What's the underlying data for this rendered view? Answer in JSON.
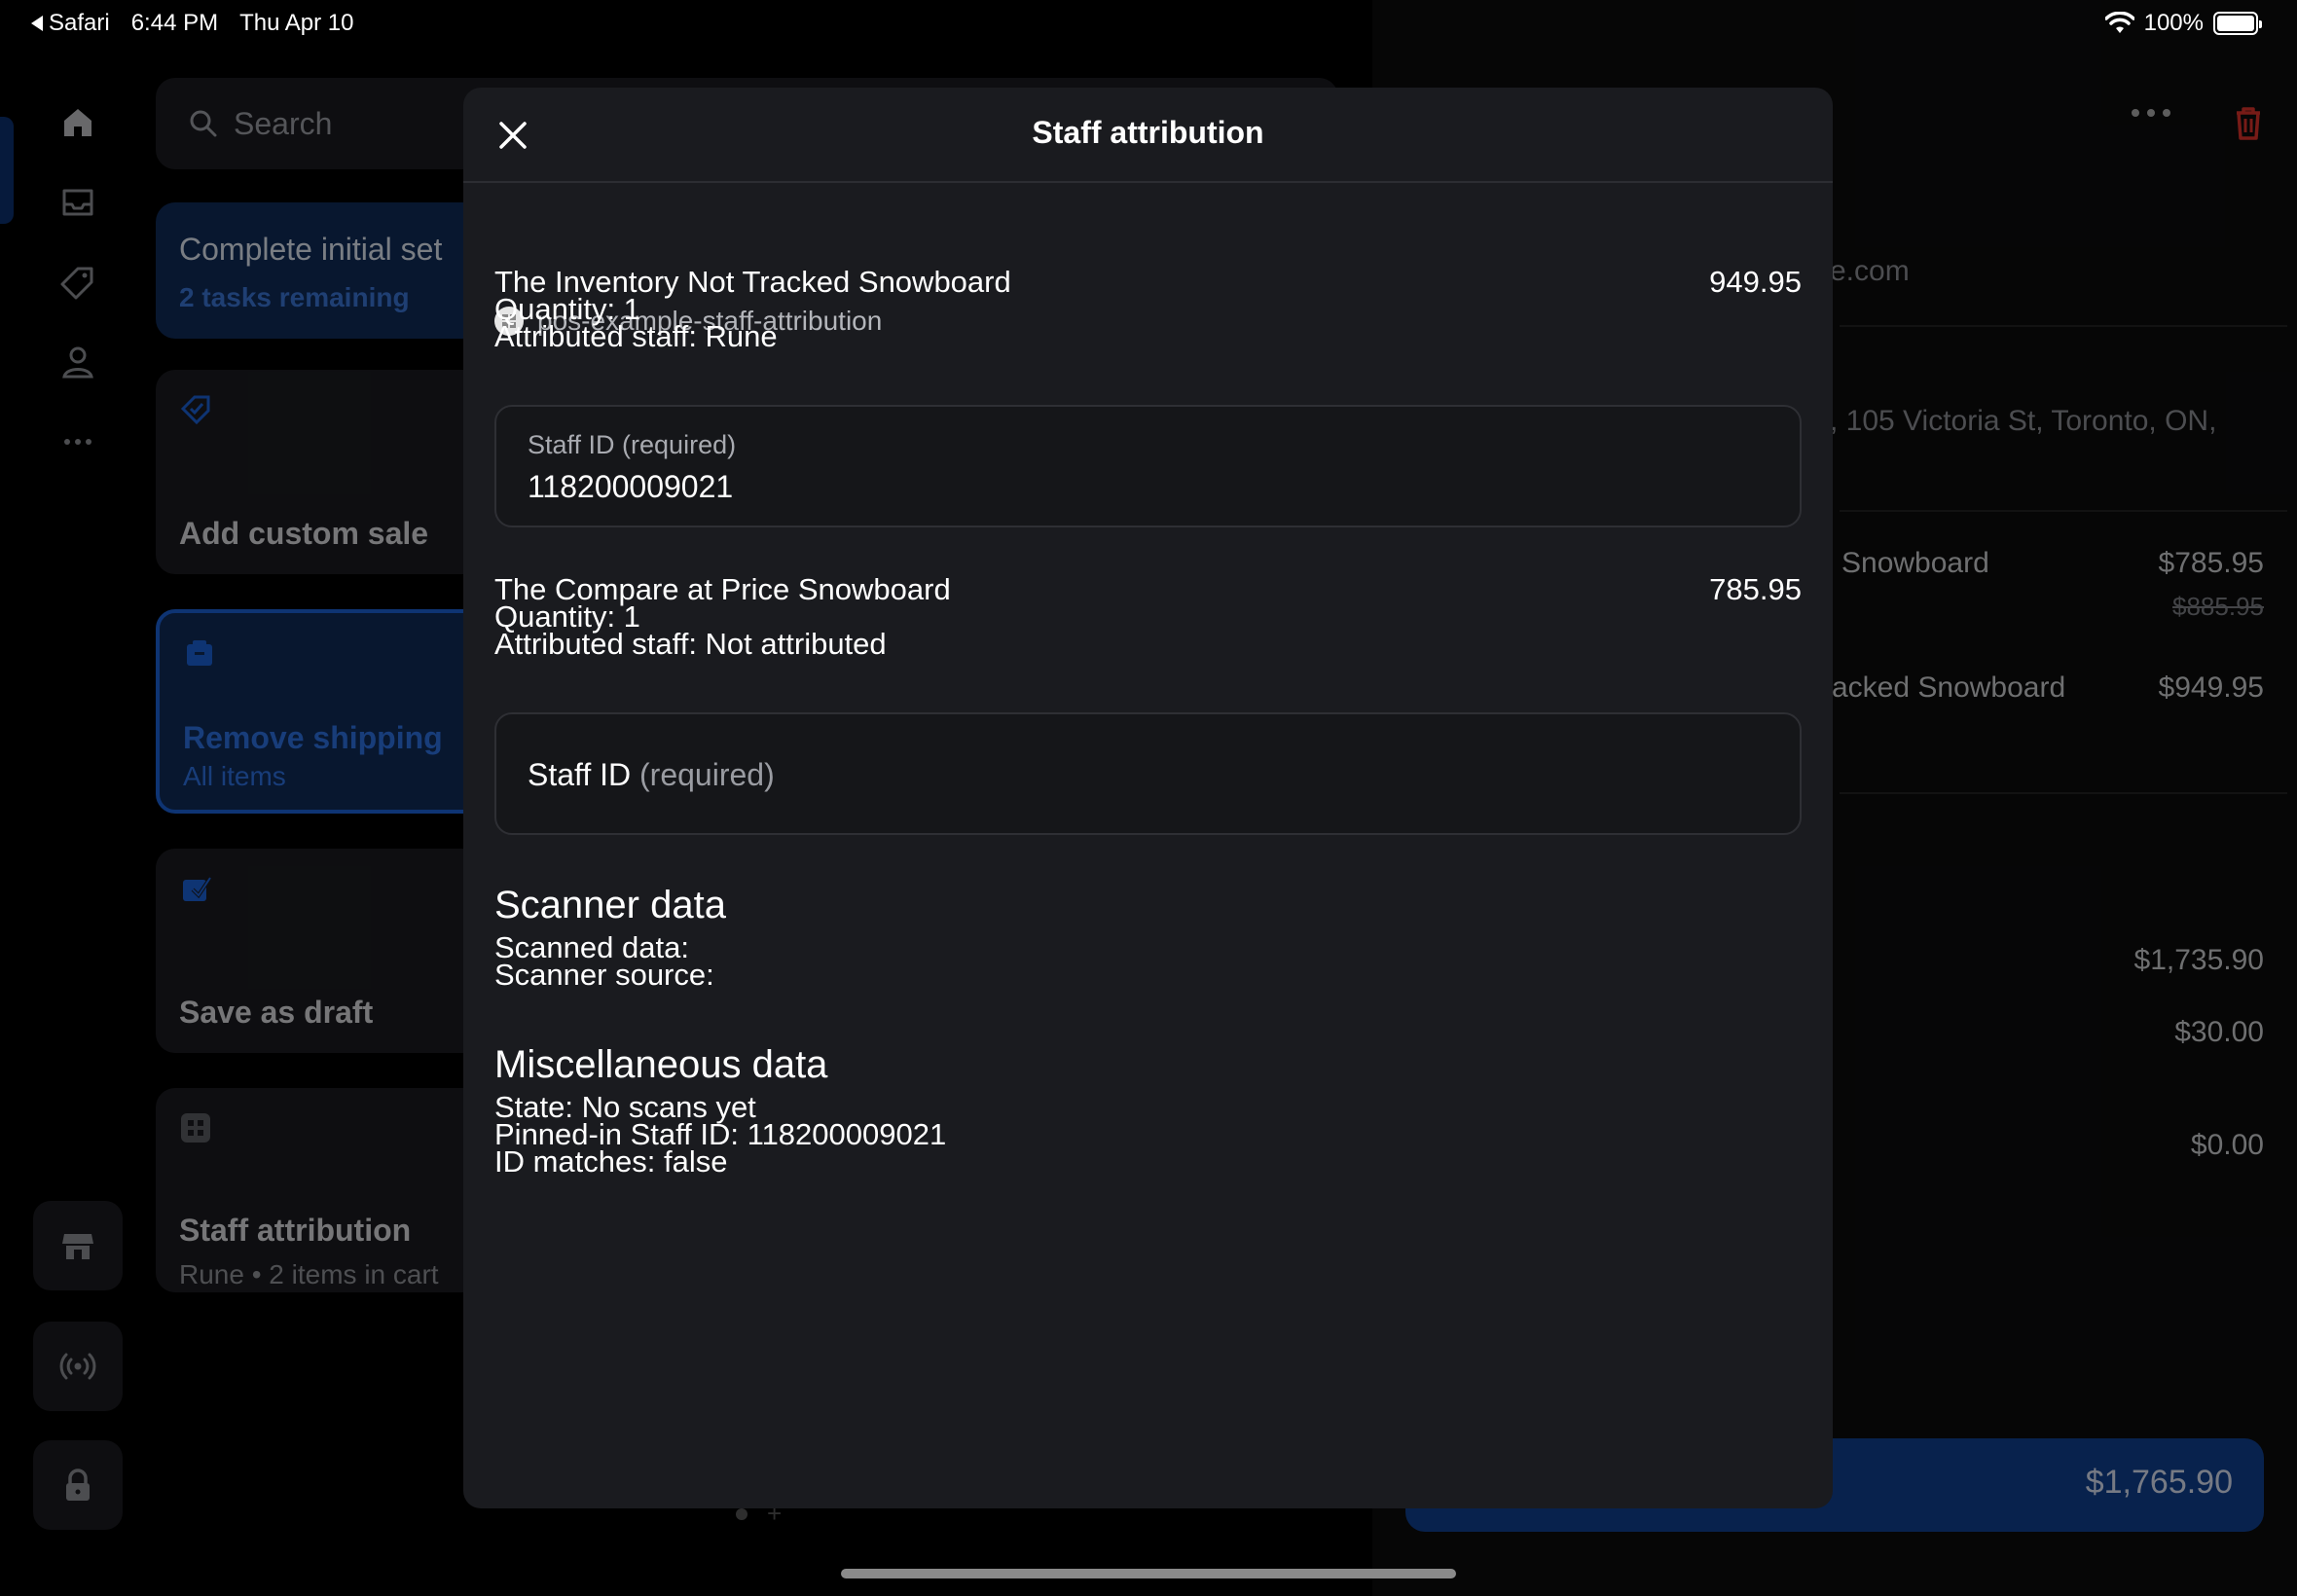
{
  "status_bar": {
    "back_app": "Safari",
    "time": "6:44 PM",
    "date": "Thu Apr 10",
    "battery": "100%"
  },
  "search": {
    "placeholder": "Search"
  },
  "tiles": {
    "setup": {
      "title": "Complete initial set",
      "sub": "2 tasks remaining"
    },
    "custom_sale": {
      "title": "Add custom sale"
    },
    "shipping": {
      "title": "Remove shipping",
      "sub": "All items"
    },
    "draft": {
      "title": "Save as draft"
    },
    "staff": {
      "title": "Staff attribution",
      "sub": "Rune • 2 items in cart"
    }
  },
  "cart": {
    "email_fragment": "e.com",
    "address_fragment": ", 105 Victoria St, Toronto, ON,",
    "items": [
      {
        "name": "Snowboard",
        "price": "$785.95",
        "old_price": "$885.95"
      },
      {
        "name": "acked Snowboard",
        "price": "$949.95"
      }
    ],
    "subtotal": "$1,735.90",
    "shipping": "$30.00",
    "tax": "$0.00",
    "charge": "$1,765.90"
  },
  "modal": {
    "title": "Staff attribution",
    "extension": "pos-example-staff-attribution",
    "items": [
      {
        "name": "The Inventory Not Tracked Snowboard",
        "price": "949.95",
        "quantity": "Quantity: 1",
        "staff": "Attributed staff: Rune",
        "field_label": "Staff ID (required)",
        "field_value": "118200009021"
      },
      {
        "name": "The Compare at Price Snowboard",
        "price": "785.95",
        "quantity": "Quantity: 1",
        "staff": "Attributed staff: Not attributed",
        "field_label_main": "Staff ID",
        "field_label_req": "(required)"
      }
    ],
    "scanner": {
      "heading": "Scanner data",
      "scanned": "Scanned data:",
      "source": "Scanner source:"
    },
    "misc": {
      "heading": "Miscellaneous data",
      "state": "State: No scans yet",
      "pinned": "Pinned-in Staff ID: 118200009021",
      "matches": "ID matches: false"
    }
  },
  "colors": {
    "accent": "#1b5fd1",
    "danger": "#d9322b",
    "modal_bg": "#1a1b1f"
  }
}
